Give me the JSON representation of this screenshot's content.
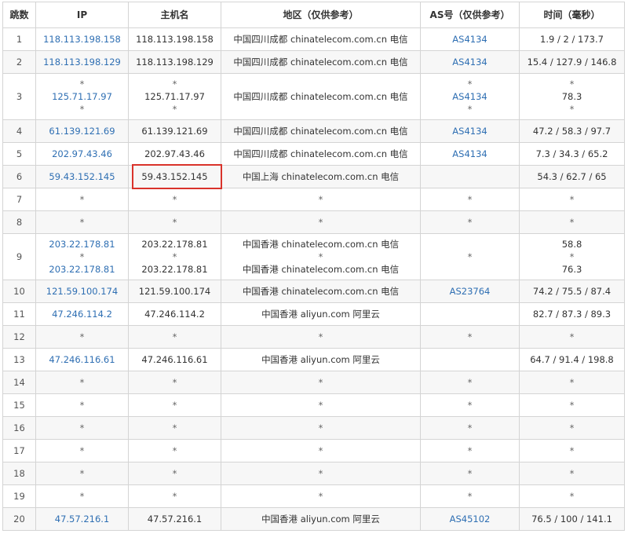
{
  "headers": {
    "hop": "跳数",
    "ip": "IP",
    "host": "主机名",
    "region": "地区（仅供参考）",
    "as": "AS号（仅供参考）",
    "time": "时间（毫秒）"
  },
  "rows": [
    {
      "hop": "1",
      "ip": [
        "118.113.198.158"
      ],
      "host": [
        "118.113.198.158"
      ],
      "region": [
        "中国四川成都 chinatelecom.com.cn 电信"
      ],
      "as": [
        "AS4134"
      ],
      "time": [
        "1.9 / 2 / 173.7"
      ]
    },
    {
      "hop": "2",
      "ip": [
        "118.113.198.129"
      ],
      "host": [
        "118.113.198.129"
      ],
      "region": [
        "中国四川成都 chinatelecom.com.cn 电信"
      ],
      "as": [
        "AS4134"
      ],
      "time": [
        "15.4 / 127.9 / 146.8"
      ]
    },
    {
      "hop": "3",
      "ip": [
        "*",
        "125.71.17.97",
        "*"
      ],
      "host": [
        "*",
        "125.71.17.97",
        "*"
      ],
      "region": [
        "中国四川成都 chinatelecom.com.cn 电信"
      ],
      "as": [
        "*",
        "AS4134",
        "*"
      ],
      "time": [
        "*",
        "78.3",
        "*"
      ]
    },
    {
      "hop": "4",
      "ip": [
        "61.139.121.69"
      ],
      "host": [
        "61.139.121.69"
      ],
      "region": [
        "中国四川成都 chinatelecom.com.cn 电信"
      ],
      "as": [
        "AS4134"
      ],
      "time": [
        "47.2 / 58.3 / 97.7"
      ]
    },
    {
      "hop": "5",
      "ip": [
        "202.97.43.46"
      ],
      "host": [
        "202.97.43.46"
      ],
      "region": [
        "中国四川成都 chinatelecom.com.cn 电信"
      ],
      "as": [
        "AS4134"
      ],
      "time": [
        "7.3 / 34.3 / 65.2"
      ]
    },
    {
      "hop": "6",
      "ip": [
        "59.43.152.145"
      ],
      "host": [
        "59.43.152.145"
      ],
      "region": [
        "中国上海 chinatelecom.com.cn 电信"
      ],
      "as": [
        ""
      ],
      "time": [
        "54.3 / 62.7 / 65"
      ],
      "highlight": true
    },
    {
      "hop": "7",
      "ip": [
        "*"
      ],
      "host": [
        "*"
      ],
      "region": [
        "*"
      ],
      "as": [
        "*"
      ],
      "time": [
        "*"
      ]
    },
    {
      "hop": "8",
      "ip": [
        "*"
      ],
      "host": [
        "*"
      ],
      "region": [
        "*"
      ],
      "as": [
        "*"
      ],
      "time": [
        "*"
      ]
    },
    {
      "hop": "9",
      "ip": [
        "203.22.178.81",
        "*",
        "203.22.178.81"
      ],
      "host": [
        "203.22.178.81",
        "*",
        "203.22.178.81"
      ],
      "region": [
        "中国香港 chinatelecom.com.cn 电信",
        "*",
        "中国香港 chinatelecom.com.cn 电信"
      ],
      "as": [
        "*"
      ],
      "time": [
        "58.8",
        "*",
        "76.3"
      ]
    },
    {
      "hop": "10",
      "ip": [
        "121.59.100.174"
      ],
      "host": [
        "121.59.100.174"
      ],
      "region": [
        "中国香港 chinatelecom.com.cn 电信"
      ],
      "as": [
        "AS23764"
      ],
      "time": [
        "74.2 / 75.5 / 87.4"
      ]
    },
    {
      "hop": "11",
      "ip": [
        "47.246.114.2"
      ],
      "host": [
        "47.246.114.2"
      ],
      "region": [
        "中国香港 aliyun.com 阿里云"
      ],
      "as": [
        ""
      ],
      "time": [
        "82.7 / 87.3 / 89.3"
      ]
    },
    {
      "hop": "12",
      "ip": [
        "*"
      ],
      "host": [
        "*"
      ],
      "region": [
        "*"
      ],
      "as": [
        "*"
      ],
      "time": [
        "*"
      ]
    },
    {
      "hop": "13",
      "ip": [
        "47.246.116.61"
      ],
      "host": [
        "47.246.116.61"
      ],
      "region": [
        "中国香港 aliyun.com 阿里云"
      ],
      "as": [
        ""
      ],
      "time": [
        "64.7 / 91.4 / 198.8"
      ]
    },
    {
      "hop": "14",
      "ip": [
        "*"
      ],
      "host": [
        "*"
      ],
      "region": [
        "*"
      ],
      "as": [
        "*"
      ],
      "time": [
        "*"
      ]
    },
    {
      "hop": "15",
      "ip": [
        "*"
      ],
      "host": [
        "*"
      ],
      "region": [
        "*"
      ],
      "as": [
        "*"
      ],
      "time": [
        "*"
      ]
    },
    {
      "hop": "16",
      "ip": [
        "*"
      ],
      "host": [
        "*"
      ],
      "region": [
        "*"
      ],
      "as": [
        "*"
      ],
      "time": [
        "*"
      ]
    },
    {
      "hop": "17",
      "ip": [
        "*"
      ],
      "host": [
        "*"
      ],
      "region": [
        "*"
      ],
      "as": [
        "*"
      ],
      "time": [
        "*"
      ]
    },
    {
      "hop": "18",
      "ip": [
        "*"
      ],
      "host": [
        "*"
      ],
      "region": [
        "*"
      ],
      "as": [
        "*"
      ],
      "time": [
        "*"
      ]
    },
    {
      "hop": "19",
      "ip": [
        "*"
      ],
      "host": [
        "*"
      ],
      "region": [
        "*"
      ],
      "as": [
        "*"
      ],
      "time": [
        "*"
      ]
    },
    {
      "hop": "20",
      "ip": [
        "47.57.216.1"
      ],
      "host": [
        "47.57.216.1"
      ],
      "region": [
        "中国香港 aliyun.com 阿里云"
      ],
      "as": [
        "AS45102"
      ],
      "time": [
        "76.5 / 100 / 141.1"
      ]
    }
  ],
  "colors": {
    "link": "#2f6fb3",
    "highlight": "#d9332b",
    "border": "#d4d4d4",
    "stripe": "#f7f7f7"
  }
}
